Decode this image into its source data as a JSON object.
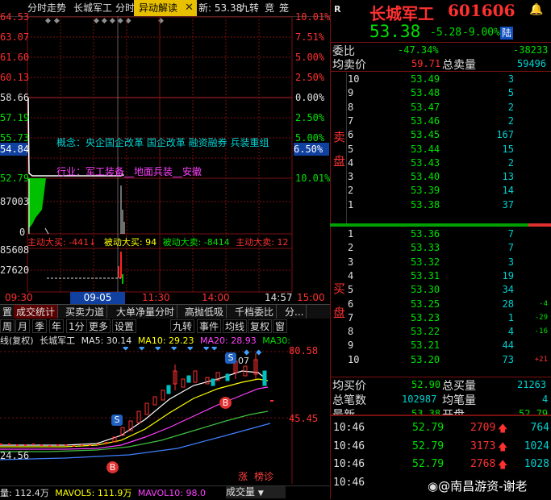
{
  "top_tabs": {
    "intraday": "分时走势",
    "stock_name": "长城军工",
    "fen": "分时",
    "yidong": "异动解读",
    "close_x": "✕",
    "latest": "新: 53.38",
    "jiuzhuan": "九转",
    "jing": "竞",
    "long": "笼"
  },
  "price_axis_left": [
    "64.53",
    "63.07",
    "61.60",
    "60.13",
    "58.66",
    "57.19",
    "55.73",
    "54.84",
    "52.79",
    "87003",
    "0",
    "85608",
    "27620"
  ],
  "pct_axis_right": [
    "10.01%",
    "7.51%",
    "5.00%",
    "2.50%",
    "0.00%",
    "2.50%",
    "5.00%",
    "6.50%",
    "10.01%"
  ],
  "chart_notes": {
    "concept": "概念：央企国企改革  国企改革  融资融券  兵装重组",
    "industry": "行业：军工装备__地面兵装__安徽"
  },
  "flow_bar": {
    "main_buy": "主动大买: -441↓",
    "passive_buy": "被动大买: 94",
    "passive_sell": "被动大卖: -8414",
    "main_sell": "主动大卖: 12"
  },
  "time_axis": {
    "t0": "09:30",
    "cursor": "09-05 10:48",
    "t1": "11:30",
    "t2": "14:00",
    "t3": "14:57",
    "t4": "15:00"
  },
  "bottom_tabs": [
    "置",
    "成交统计",
    "买卖力道",
    "大单净量分时",
    "高抛低吸",
    "千档委比",
    "分..."
  ],
  "toolbar": [
    "周",
    "月",
    "季",
    "年",
    "1分",
    "更多",
    "设置",
    "九转",
    "事件",
    "均线",
    "复权",
    "窗"
  ],
  "kline_header": {
    "fuquan": "线(复权)",
    "name": "长城军工",
    "ma5": "MA5: 30.14",
    "ma10": "MA10: 29.23",
    "ma20": "MA20: 28.93",
    "ma30": "MA30:",
    "price_top": "80.58",
    "price_mid": "45.45",
    "price_low": "24.56",
    "marker_s": "S",
    "marker_b": "B",
    "marker_07": "07",
    "zhang": "涨",
    "bangzhen": "榜诊"
  },
  "volume_bar": {
    "vol": "量: 112.4万",
    "mavol5": "MAVOL5: 111.9万",
    "mavol10": "MAVOL10: 98.0",
    "chengjiaoliang": "成交量"
  },
  "quote": {
    "r_label": "R",
    "name": "长城军工",
    "code": "601606",
    "price": "53.38",
    "change": "-5.28",
    "pct": "-9.00%",
    "lu": "陆",
    "weibi_label": "委比",
    "weibi": "-47.34%",
    "weicha": "-38233",
    "avg_sell_label": "均卖价",
    "avg_sell": "59.71",
    "total_sell_label": "总卖量",
    "total_sell": "59496",
    "avg_buy_label": "均买价",
    "avg_buy": "52.90",
    "total_buy_label": "总买量",
    "total_buy": "21263",
    "total_num_label": "总笔数",
    "total_num": "102987",
    "avg_vol_label": "均笔量",
    "avg_vol": "4",
    "latest_label": "最新",
    "open_label": "开盘",
    "latest": "53.38",
    "open": "52.79",
    "sell_side": "卖\n盘",
    "buy_side": "买\n盘"
  },
  "asks": [
    {
      "lvl": "10",
      "price": "53.49",
      "vol": "3",
      "chg": ""
    },
    {
      "lvl": "9",
      "price": "53.48",
      "vol": "5",
      "chg": ""
    },
    {
      "lvl": "8",
      "price": "53.47",
      "vol": "2",
      "chg": ""
    },
    {
      "lvl": "7",
      "price": "53.46",
      "vol": "2",
      "chg": ""
    },
    {
      "lvl": "6",
      "price": "53.45",
      "vol": "167",
      "chg": ""
    },
    {
      "lvl": "5",
      "price": "53.44",
      "vol": "15",
      "chg": ""
    },
    {
      "lvl": "4",
      "price": "53.43",
      "vol": "2",
      "chg": ""
    },
    {
      "lvl": "3",
      "price": "53.40",
      "vol": "13",
      "chg": ""
    },
    {
      "lvl": "2",
      "price": "53.39",
      "vol": "14",
      "chg": ""
    },
    {
      "lvl": "1",
      "price": "53.38",
      "vol": "37",
      "chg": ""
    }
  ],
  "bids": [
    {
      "lvl": "1",
      "price": "53.36",
      "vol": "7",
      "chg": ""
    },
    {
      "lvl": "2",
      "price": "53.33",
      "vol": "7",
      "chg": ""
    },
    {
      "lvl": "3",
      "price": "53.32",
      "vol": "3",
      "chg": ""
    },
    {
      "lvl": "4",
      "price": "53.31",
      "vol": "19",
      "chg": ""
    },
    {
      "lvl": "5",
      "price": "53.30",
      "vol": "34",
      "chg": ""
    },
    {
      "lvl": "6",
      "price": "53.25",
      "vol": "28",
      "chg": "-4"
    },
    {
      "lvl": "7",
      "price": "53.23",
      "vol": "1",
      "chg": "-29"
    },
    {
      "lvl": "8",
      "price": "53.22",
      "vol": "4",
      "chg": "-16"
    },
    {
      "lvl": "9",
      "price": "53.21",
      "vol": "44",
      "chg": ""
    },
    {
      "lvl": "10",
      "price": "53.20",
      "vol": "73",
      "chg": "+21"
    }
  ],
  "ticks": [
    {
      "time": "10:46",
      "price": "52.79",
      "vol": "2709",
      "right": "764"
    },
    {
      "time": "10:46",
      "price": "52.79",
      "vol": "3173",
      "right": "1024"
    },
    {
      "time": "10:46",
      "price": "52.79",
      "vol": "2768",
      "right": "1028"
    },
    {
      "time": "10:46",
      "price": "",
      "vol": "",
      "right": ""
    }
  ],
  "watermark": "@南昌游资-谢老",
  "icons": {
    "alert": "bell-icon",
    "up_arrow": "up-arrow-icon"
  }
}
